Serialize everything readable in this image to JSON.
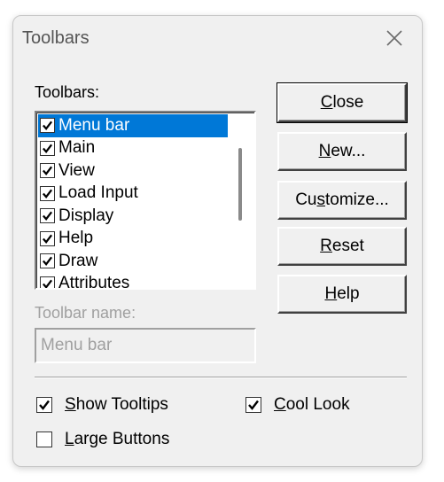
{
  "window": {
    "title": "Toolbars"
  },
  "toolbars_label": "Toolbars:",
  "toolbar_list": [
    {
      "label": "Menu bar",
      "checked": true,
      "selected": true
    },
    {
      "label": "Main",
      "checked": true,
      "selected": false
    },
    {
      "label": "View",
      "checked": true,
      "selected": false
    },
    {
      "label": "Load Input",
      "checked": true,
      "selected": false
    },
    {
      "label": "Display",
      "checked": true,
      "selected": false
    },
    {
      "label": "Help",
      "checked": true,
      "selected": false
    },
    {
      "label": "Draw",
      "checked": true,
      "selected": false
    },
    {
      "label": "Attributes",
      "checked": true,
      "selected": false
    }
  ],
  "buttons": {
    "close": {
      "pre": "",
      "key": "C",
      "post": "lose"
    },
    "new": {
      "pre": "",
      "key": "N",
      "post": "ew..."
    },
    "customize": {
      "pre": "Cu",
      "key": "s",
      "post": "tomize..."
    },
    "reset": {
      "pre": "",
      "key": "R",
      "post": "eset"
    },
    "help": {
      "pre": "",
      "key": "H",
      "post": "elp"
    }
  },
  "toolbar_name": {
    "label": "Toolbar name:",
    "value": "Menu bar"
  },
  "options": {
    "show_tooltips": {
      "pre": "",
      "key": "S",
      "post": "how Tooltips",
      "checked": true
    },
    "cool_look": {
      "pre": "",
      "key": "C",
      "post": "ool Look",
      "checked": true
    },
    "large_buttons": {
      "pre": "",
      "key": "L",
      "post": "arge Buttons",
      "checked": false
    }
  },
  "colors": {
    "selection": "#0078d7",
    "face": "#f0f0f0",
    "disabled_text": "#a0a0a0"
  }
}
